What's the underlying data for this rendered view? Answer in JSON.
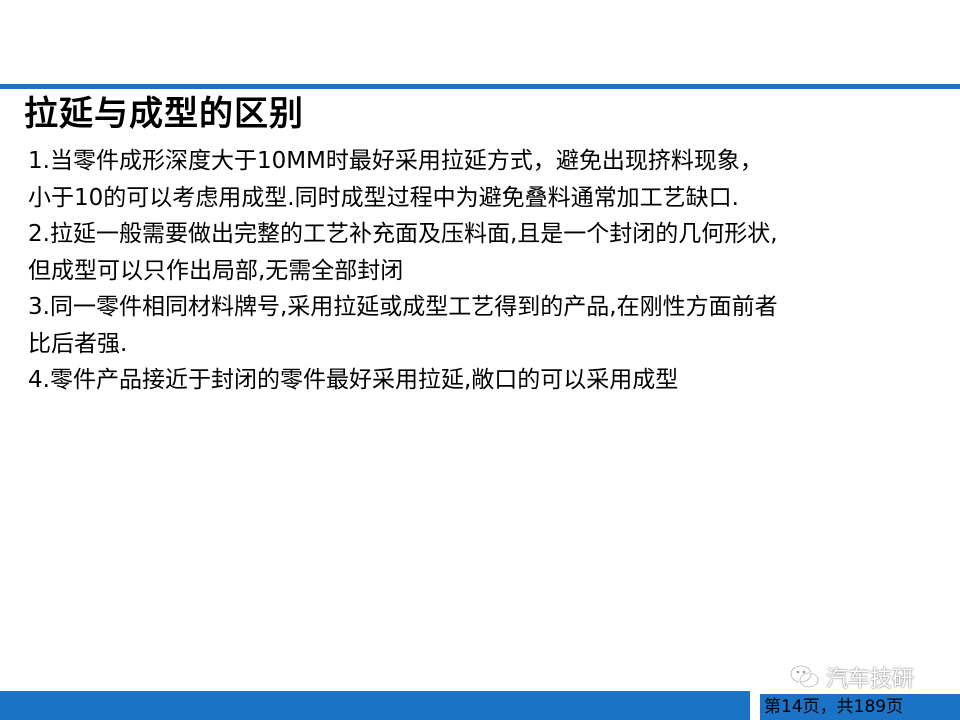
{
  "slide": {
    "title": "拉延与成型的区别",
    "lines": [
      "1.当零件成形深度大于10MM时最好采用拉延方式，避免出现挤料现象，",
      "小于10的可以考虑用成型.同时成型过程中为避免叠料通常加工艺缺口.",
      "2.拉延一般需要做出完整的工艺补充面及压料面,且是一个封闭的几何形状,",
      "但成型可以只作出局部,无需全部封闭",
      "3.同一零件相同材料牌号,采用拉延或成型工艺得到的产品,在刚性方面前者",
      "比后者强.",
      "4.零件产品接近于封闭的零件最好采用拉延,敞口的可以采用成型"
    ]
  },
  "footer": {
    "page_counter": "第14页，共189页"
  },
  "watermark": {
    "text": "汽车技研",
    "icon": "wechat-icon"
  },
  "colors": {
    "accent": "#1a73c4"
  }
}
